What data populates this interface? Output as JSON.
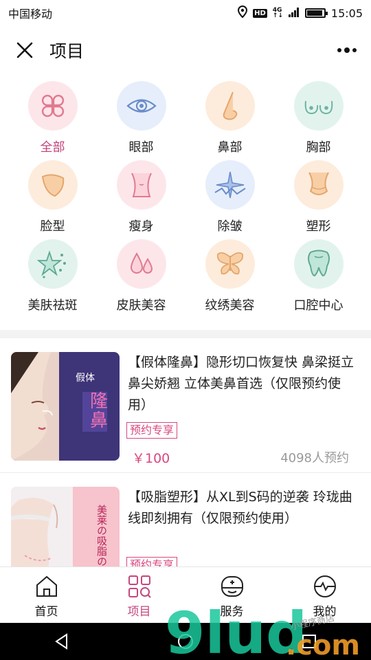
{
  "status": {
    "carrier": "中国移动",
    "hd": "HD",
    "net_top": "4G",
    "net_bottom": "↑↓",
    "battery_level": 0.85,
    "time": "15:05"
  },
  "header": {
    "title": "项目"
  },
  "categories": [
    {
      "label": "全部",
      "icon": "grid-quatrefoil-icon",
      "bg": "#fde6ea",
      "active": true
    },
    {
      "label": "眼部",
      "icon": "eye-icon",
      "bg": "#e6eefb"
    },
    {
      "label": "鼻部",
      "icon": "nose-icon",
      "bg": "#fdecdc"
    },
    {
      "label": "胸部",
      "icon": "chest-icon",
      "bg": "#e2f3ee"
    },
    {
      "label": "脸型",
      "icon": "face-shape-icon",
      "bg": "#fdecdc"
    },
    {
      "label": "瘦身",
      "icon": "waist-icon",
      "bg": "#fde6ea"
    },
    {
      "label": "除皱",
      "icon": "wrinkle-sparkle-icon",
      "bg": "#e6eefb"
    },
    {
      "label": "塑形",
      "icon": "body-contour-icon",
      "bg": "#fdecdc"
    },
    {
      "label": "美肤祛斑",
      "icon": "skin-sparkle-icon",
      "bg": "#e2f3ee"
    },
    {
      "label": "皮肤美容",
      "icon": "water-drops-icon",
      "bg": "#fde6ea"
    },
    {
      "label": "纹绣美容",
      "icon": "butterfly-icon",
      "bg": "#fdecdc"
    },
    {
      "label": "口腔中心",
      "icon": "tooth-icon",
      "bg": "#e2f3ee"
    }
  ],
  "products": [
    {
      "title": "【假体隆鼻】隐形切口恢复快 鼻梁挺立鼻尖娇翘 立体美鼻首选（仅限预约使用）",
      "badge": "预约专享",
      "price": "￥100",
      "bookings": "4098人预约",
      "thumb_text": [
        "假体",
        "隆",
        "鼻"
      ]
    },
    {
      "title": "【吸脂塑形】从XL到S码的逆袭 玲珑曲线即刻拥有（仅限预约使用）",
      "badge": "预约专享",
      "thumb_text": [
        "美莱の吸脂の塑"
      ]
    }
  ],
  "tabs": [
    {
      "label": "首页",
      "icon": "home-icon"
    },
    {
      "label": "项目",
      "icon": "grid-search-icon",
      "active": true
    },
    {
      "label": "服务",
      "icon": "service-face-icon"
    },
    {
      "label": "我的",
      "icon": "profile-pulse-icon"
    }
  ],
  "watermark": {
    "text": "9lud",
    "suffix": ".com",
    "tagline": "小程序商店"
  },
  "colors": {
    "accent": "#c4467d",
    "price": "#d9477f"
  }
}
